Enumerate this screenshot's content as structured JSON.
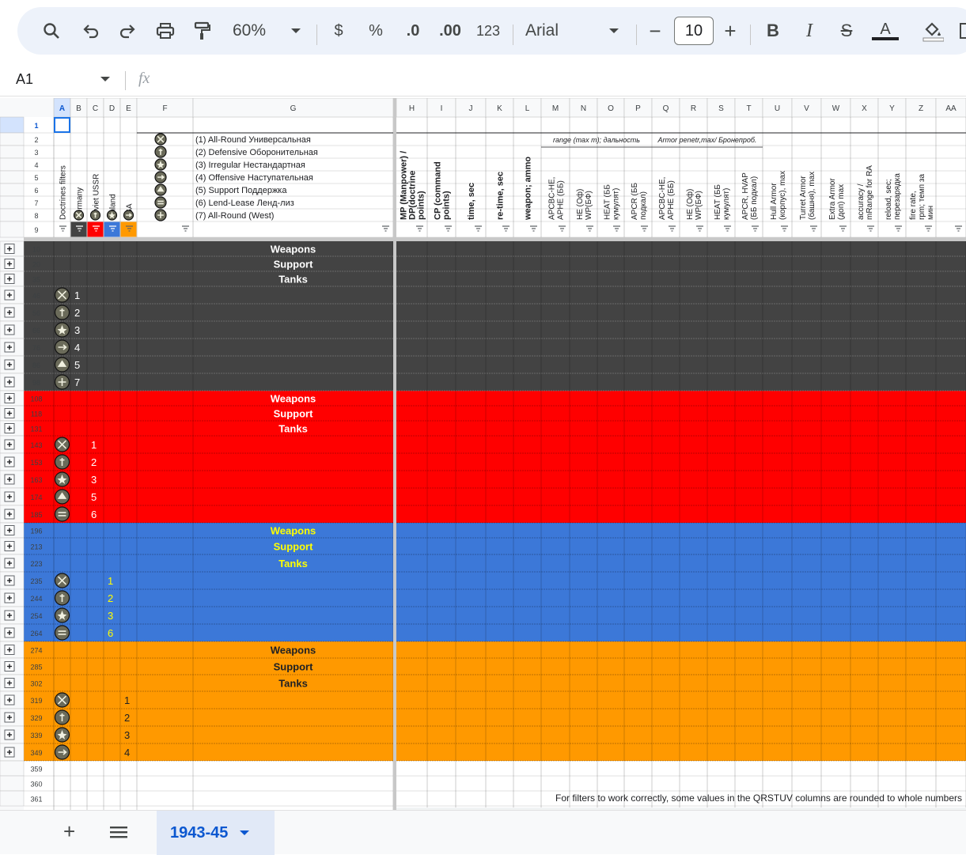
{
  "toolbar": {
    "zoom": "60%",
    "font": "Arial",
    "font_size": "10",
    "fmt_currency": "$",
    "fmt_percent": "%",
    "fmt_dec_less": ".0",
    "fmt_dec_more": ".00",
    "fmt_more": "123"
  },
  "namebox": "A1",
  "fx": "fx",
  "columns": [
    "A",
    "B",
    "C",
    "D",
    "E",
    "F",
    "G",
    "H",
    "I",
    "J",
    "K",
    "L",
    "M",
    "N",
    "O",
    "P",
    "Q",
    "R",
    "S",
    "T",
    "U",
    "V",
    "W",
    "X",
    "Y",
    "Z",
    "AA"
  ],
  "doctrines": [
    "(1) All-Round Универсальная",
    "(2) Defensive Оборонительная",
    "(3) Irregular Нестандартная",
    "(4) Offensive Наступательная",
    "(5) Support Поддержка",
    "(6) Lend-Lease Ленд-лиз",
    "(7) All-Round (West)"
  ],
  "vheaders": {
    "A": "Doctrines filters",
    "B": "Germany",
    "C": "Soviet USSR",
    "D": "Finland",
    "E": "USA",
    "H": "MP (Manpower) / DP(doctrine points)",
    "I": "CP (command points)",
    "J": "time, sec",
    "K": "re-time, sec",
    "L": "weapon; ammo",
    "M": "APCBC-HE, APHE (ББ)",
    "N": "HE (Оф) WP(БФ)",
    "O": "HEAT (ББ кумулят)",
    "P": "APCR (ББ подкал)",
    "Q": "APCBC-HE, APHE (ББ)",
    "R": "HE (Оф) WP(БФ)",
    "S": "HEAT (ББ кумулят)",
    "T": "APCR, HVAP (ББ подкал)",
    "U": "Hull Armor (корпус), max",
    "V": "Turret Armor (башня), max",
    "W": "Extra Armor (доп) max",
    "X": "accuracy / mRange for RA",
    "Y": "reload, sec; перезарядка",
    "Z": "fire rate, rpm; темп за мин"
  },
  "group_headers": {
    "range": "range (max m); дальность",
    "armor": "Armor penetr,max/ Бронепроб."
  },
  "row_labels": {
    "weapons": "Weapons",
    "support": "Support",
    "tanks": "Tanks"
  },
  "rows": [
    {
      "n": "1"
    },
    {
      "n": "2"
    },
    {
      "n": "3"
    },
    {
      "n": "4"
    },
    {
      "n": "5"
    },
    {
      "n": "6"
    },
    {
      "n": "7"
    },
    {
      "n": "8"
    },
    {
      "n": "9"
    },
    {
      "n": "10",
      "sec": "ger",
      "lbl": "weapons"
    },
    {
      "n": "20",
      "sec": "ger",
      "lbl": "support"
    },
    {
      "n": "35",
      "sec": "ger",
      "lbl": "tanks"
    },
    {
      "n": "46",
      "sec": "ger",
      "icon": 1,
      "num": "1"
    },
    {
      "n": "56",
      "sec": "ger",
      "icon": 2,
      "num": "2"
    },
    {
      "n": "66",
      "sec": "ger",
      "icon": 3,
      "num": "3"
    },
    {
      "n": "76",
      "sec": "ger",
      "icon": 4,
      "num": "4"
    },
    {
      "n": "86",
      "sec": "ger",
      "icon": 5,
      "num": "5"
    },
    {
      "n": "98",
      "sec": "ger",
      "icon": 7,
      "num": "7"
    },
    {
      "n": "108",
      "sec": "sov",
      "lbl": "weapons"
    },
    {
      "n": "118",
      "sec": "sov",
      "lbl": "support"
    },
    {
      "n": "131",
      "sec": "sov",
      "lbl": "tanks"
    },
    {
      "n": "143",
      "sec": "sov",
      "icon": 1,
      "num": "1"
    },
    {
      "n": "153",
      "sec": "sov",
      "icon": 2,
      "num": "2"
    },
    {
      "n": "163",
      "sec": "sov",
      "icon": 3,
      "num": "3"
    },
    {
      "n": "174",
      "sec": "sov",
      "icon": 5,
      "num": "5"
    },
    {
      "n": "185",
      "sec": "sov",
      "icon": 6,
      "num": "6"
    },
    {
      "n": "196",
      "sec": "fin",
      "lbl": "weapons"
    },
    {
      "n": "213",
      "sec": "fin",
      "lbl": "support"
    },
    {
      "n": "223",
      "sec": "fin",
      "lbl": "tanks"
    },
    {
      "n": "235",
      "sec": "fin",
      "icon": 1,
      "num": "1"
    },
    {
      "n": "244",
      "sec": "fin",
      "icon": 2,
      "num": "2"
    },
    {
      "n": "254",
      "sec": "fin",
      "icon": 3,
      "num": "3"
    },
    {
      "n": "264",
      "sec": "fin",
      "icon": 6,
      "num": "6"
    },
    {
      "n": "274",
      "sec": "usa",
      "lbl": "weapons"
    },
    {
      "n": "285",
      "sec": "usa",
      "lbl": "support"
    },
    {
      "n": "302",
      "sec": "usa",
      "lbl": "tanks"
    },
    {
      "n": "319",
      "sec": "usa",
      "icon": 1,
      "num": "1"
    },
    {
      "n": "329",
      "sec": "usa",
      "icon": 2,
      "num": "2"
    },
    {
      "n": "339",
      "sec": "usa",
      "icon": 3,
      "num": "3"
    },
    {
      "n": "349",
      "sec": "usa",
      "icon": 4,
      "num": "4"
    },
    {
      "n": "359"
    },
    {
      "n": "360"
    },
    {
      "n": "361"
    }
  ],
  "footnote": "For filters to work correctly, some values in the QRSTUV columns are rounded to whole numbers",
  "sheet_tab": "1943-45",
  "colors": {
    "ger": "#434343",
    "sov": "#ff0000",
    "fin": "#3c78d8",
    "usa": "#ff9900",
    "fin_text": "#ffff00",
    "header_bg": "#f8f9fa",
    "selected": "#d3e3fd",
    "accent": "#0b57d0"
  }
}
